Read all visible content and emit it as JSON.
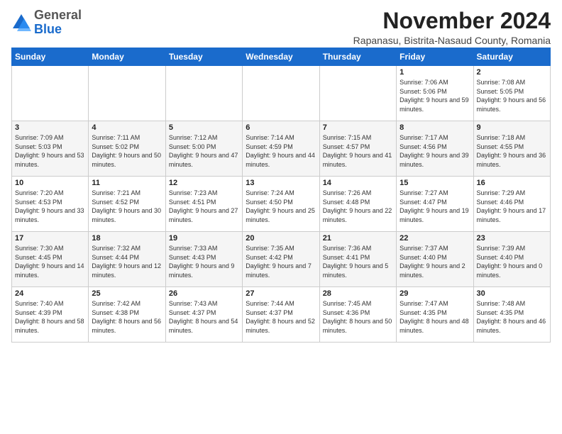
{
  "logo": {
    "general": "General",
    "blue": "Blue"
  },
  "header": {
    "month": "November 2024",
    "location": "Rapanasu, Bistrita-Nasaud County, Romania"
  },
  "weekdays": [
    "Sunday",
    "Monday",
    "Tuesday",
    "Wednesday",
    "Thursday",
    "Friday",
    "Saturday"
  ],
  "weeks": [
    [
      {
        "day": "",
        "info": ""
      },
      {
        "day": "",
        "info": ""
      },
      {
        "day": "",
        "info": ""
      },
      {
        "day": "",
        "info": ""
      },
      {
        "day": "",
        "info": ""
      },
      {
        "day": "1",
        "info": "Sunrise: 7:06 AM\nSunset: 5:06 PM\nDaylight: 9 hours and 59 minutes."
      },
      {
        "day": "2",
        "info": "Sunrise: 7:08 AM\nSunset: 5:05 PM\nDaylight: 9 hours and 56 minutes."
      }
    ],
    [
      {
        "day": "3",
        "info": "Sunrise: 7:09 AM\nSunset: 5:03 PM\nDaylight: 9 hours and 53 minutes."
      },
      {
        "day": "4",
        "info": "Sunrise: 7:11 AM\nSunset: 5:02 PM\nDaylight: 9 hours and 50 minutes."
      },
      {
        "day": "5",
        "info": "Sunrise: 7:12 AM\nSunset: 5:00 PM\nDaylight: 9 hours and 47 minutes."
      },
      {
        "day": "6",
        "info": "Sunrise: 7:14 AM\nSunset: 4:59 PM\nDaylight: 9 hours and 44 minutes."
      },
      {
        "day": "7",
        "info": "Sunrise: 7:15 AM\nSunset: 4:57 PM\nDaylight: 9 hours and 41 minutes."
      },
      {
        "day": "8",
        "info": "Sunrise: 7:17 AM\nSunset: 4:56 PM\nDaylight: 9 hours and 39 minutes."
      },
      {
        "day": "9",
        "info": "Sunrise: 7:18 AM\nSunset: 4:55 PM\nDaylight: 9 hours and 36 minutes."
      }
    ],
    [
      {
        "day": "10",
        "info": "Sunrise: 7:20 AM\nSunset: 4:53 PM\nDaylight: 9 hours and 33 minutes."
      },
      {
        "day": "11",
        "info": "Sunrise: 7:21 AM\nSunset: 4:52 PM\nDaylight: 9 hours and 30 minutes."
      },
      {
        "day": "12",
        "info": "Sunrise: 7:23 AM\nSunset: 4:51 PM\nDaylight: 9 hours and 27 minutes."
      },
      {
        "day": "13",
        "info": "Sunrise: 7:24 AM\nSunset: 4:50 PM\nDaylight: 9 hours and 25 minutes."
      },
      {
        "day": "14",
        "info": "Sunrise: 7:26 AM\nSunset: 4:48 PM\nDaylight: 9 hours and 22 minutes."
      },
      {
        "day": "15",
        "info": "Sunrise: 7:27 AM\nSunset: 4:47 PM\nDaylight: 9 hours and 19 minutes."
      },
      {
        "day": "16",
        "info": "Sunrise: 7:29 AM\nSunset: 4:46 PM\nDaylight: 9 hours and 17 minutes."
      }
    ],
    [
      {
        "day": "17",
        "info": "Sunrise: 7:30 AM\nSunset: 4:45 PM\nDaylight: 9 hours and 14 minutes."
      },
      {
        "day": "18",
        "info": "Sunrise: 7:32 AM\nSunset: 4:44 PM\nDaylight: 9 hours and 12 minutes."
      },
      {
        "day": "19",
        "info": "Sunrise: 7:33 AM\nSunset: 4:43 PM\nDaylight: 9 hours and 9 minutes."
      },
      {
        "day": "20",
        "info": "Sunrise: 7:35 AM\nSunset: 4:42 PM\nDaylight: 9 hours and 7 minutes."
      },
      {
        "day": "21",
        "info": "Sunrise: 7:36 AM\nSunset: 4:41 PM\nDaylight: 9 hours and 5 minutes."
      },
      {
        "day": "22",
        "info": "Sunrise: 7:37 AM\nSunset: 4:40 PM\nDaylight: 9 hours and 2 minutes."
      },
      {
        "day": "23",
        "info": "Sunrise: 7:39 AM\nSunset: 4:40 PM\nDaylight: 9 hours and 0 minutes."
      }
    ],
    [
      {
        "day": "24",
        "info": "Sunrise: 7:40 AM\nSunset: 4:39 PM\nDaylight: 8 hours and 58 minutes."
      },
      {
        "day": "25",
        "info": "Sunrise: 7:42 AM\nSunset: 4:38 PM\nDaylight: 8 hours and 56 minutes."
      },
      {
        "day": "26",
        "info": "Sunrise: 7:43 AM\nSunset: 4:37 PM\nDaylight: 8 hours and 54 minutes."
      },
      {
        "day": "27",
        "info": "Sunrise: 7:44 AM\nSunset: 4:37 PM\nDaylight: 8 hours and 52 minutes."
      },
      {
        "day": "28",
        "info": "Sunrise: 7:45 AM\nSunset: 4:36 PM\nDaylight: 8 hours and 50 minutes."
      },
      {
        "day": "29",
        "info": "Sunrise: 7:47 AM\nSunset: 4:35 PM\nDaylight: 8 hours and 48 minutes."
      },
      {
        "day": "30",
        "info": "Sunrise: 7:48 AM\nSunset: 4:35 PM\nDaylight: 8 hours and 46 minutes."
      }
    ]
  ]
}
